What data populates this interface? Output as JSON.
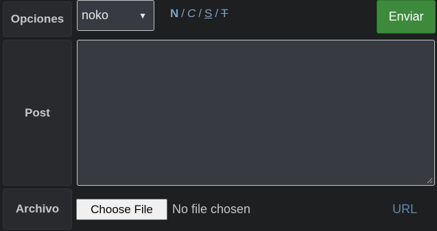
{
  "labels": {
    "opciones": "Opciones",
    "post": "Post",
    "archivo": "Archivo"
  },
  "options_select": {
    "selected": "noko",
    "caret": "▼"
  },
  "format": {
    "bold": "N",
    "italic": "C",
    "underline": "S",
    "strike": "T",
    "separator": "/"
  },
  "submit": {
    "label": "Enviar"
  },
  "post": {
    "value": ""
  },
  "file": {
    "button_label": "Choose File",
    "status": "No file chosen"
  },
  "url_link": "URL",
  "colors": {
    "background": "#1d1f21",
    "label_bg": "#282a2e",
    "input_bg": "#373b41",
    "accent_link": "#81a2be",
    "submit_green": "#3d8a3d"
  }
}
